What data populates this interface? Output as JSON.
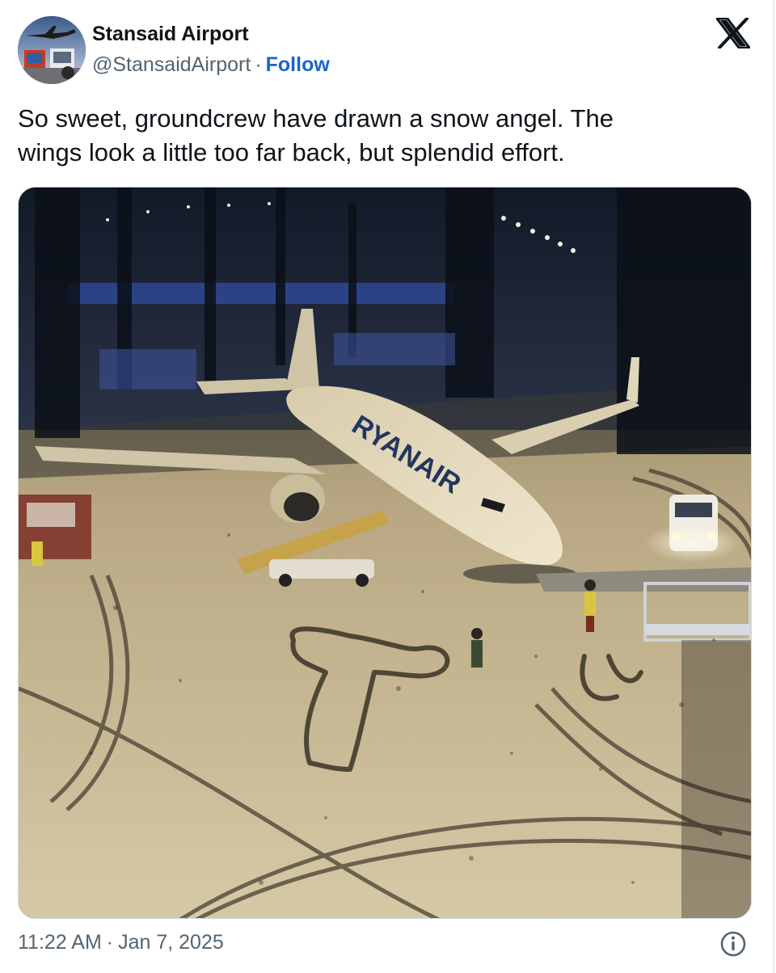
{
  "author": {
    "display_name": "Stansaid Airport",
    "handle": "@StansaidAirport",
    "separator": "·",
    "follow_label": "Follow"
  },
  "icons": {
    "brand": "x-logo-icon",
    "info": "info-icon",
    "avatar": "avatar"
  },
  "tweet": {
    "text": "So sweet, groundcrew have drawn a snow angel. The\nwings look a little too far back, but splendid effort.",
    "time": "11:22 AM",
    "separator": "·",
    "date": "Jan 7, 2025"
  },
  "media": {
    "airline_livery": "RYANAIR"
  },
  "colors": {
    "text_primary": "#0f1419",
    "text_secondary": "#536471",
    "follow": "#1d64c8",
    "border": "#cfd9de"
  }
}
